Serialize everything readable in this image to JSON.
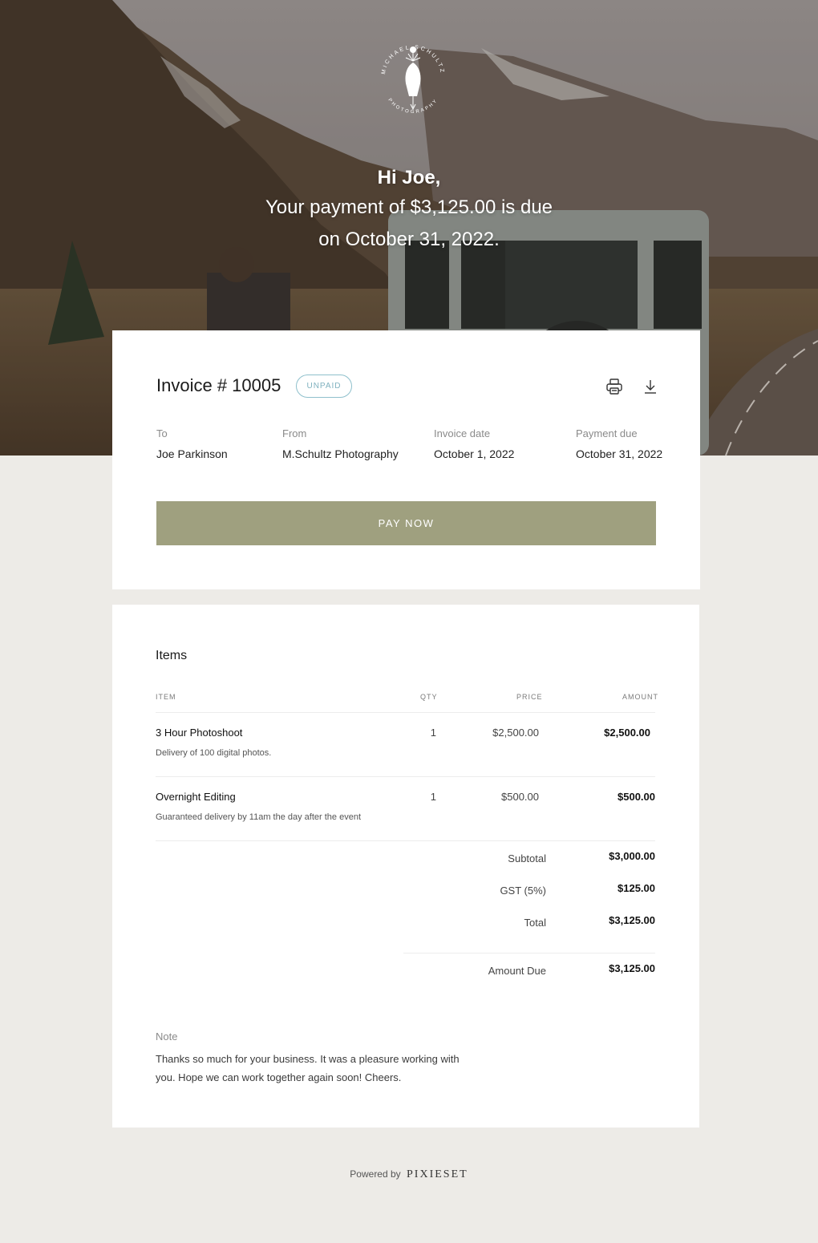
{
  "hero": {
    "logo_text_top": "MICHAEL SCHULTZ",
    "logo_text_bottom": "PHOTOGRAPHY",
    "greeting": "Hi Joe,",
    "line1": "Your payment of $3,125.00 is due",
    "line2": "on October 31, 2022."
  },
  "invoice": {
    "title": "Invoice # 10005",
    "status": "UNPAID",
    "icons": {
      "print": "printer-icon",
      "download": "download-icon"
    },
    "meta": {
      "to_label": "To",
      "to_value": "Joe Parkinson",
      "from_label": "From",
      "from_value": "M.Schultz Photography",
      "date_label": "Invoice date",
      "date_value": "October 1, 2022",
      "due_label": "Payment due",
      "due_value": "October 31, 2022"
    },
    "pay_button": "PAY NOW"
  },
  "items": {
    "heading": "Items",
    "columns": [
      "ITEM",
      "QTY",
      "PRICE",
      "AMOUNT"
    ],
    "rows": [
      {
        "name": "3 Hour Photoshoot",
        "description": "Delivery of 100 digital photos.",
        "qty": "1",
        "price": "$2,500.00",
        "amount": "$2,500.00"
      },
      {
        "name": "Overnight Editing",
        "description": "Guaranteed delivery by 11am the day after the event",
        "qty": "1",
        "price": "$500.00",
        "amount": "$500.00"
      }
    ],
    "summary": {
      "subtotal_label": "Subtotal",
      "subtotal": "$3,000.00",
      "gst_label": "GST (5%)",
      "gst": "$125.00",
      "total_label": "Total",
      "total": "$3,125.00",
      "amount_due_label": "Amount Due",
      "amount_due": "$3,125.00"
    },
    "note_label": "Note",
    "note_text": "Thanks so much for your business. It was a pleasure working with you. Hope we can work together again soon! Cheers."
  },
  "footer": {
    "powered_by": "Powered by",
    "brand": "PIXIESET"
  },
  "colors": {
    "pay_button": "#9fa07f",
    "page_bg": "#edebe7",
    "badge": "#7fb1bf"
  }
}
